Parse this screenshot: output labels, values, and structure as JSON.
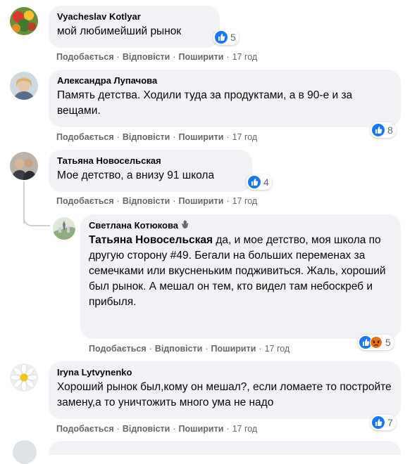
{
  "comments": [
    {
      "author": "Vyacheslav Kotlyar",
      "text": "мой любимейший рынок",
      "reactions": "5",
      "like": "Подобається",
      "reply": "Відповісти",
      "share": "Поширити",
      "time": "17 год"
    },
    {
      "author": "Александра Лупачова",
      "text": "Память детства. Ходили туда за продуктами, а в 90-е и за вещами.",
      "reactions": "8",
      "like": "Подобається",
      "reply": "Відповісти",
      "share": "Поширити",
      "time": "17 год"
    },
    {
      "author": "Татьяна Новосельская",
      "text": "Мое детство, а внизу 91 школа",
      "reactions": "4",
      "like": "Подобається",
      "reply": "Відповісти",
      "share": "Поширити",
      "time": "17 год"
    },
    {
      "author": "Светлана Котюкова",
      "mention": "Татьяна Новосельская",
      "text": " да, и мое детство, моя школа по другую сторону #49. Бегали на больших переменах за семечками или вкусненьким подживиться. Жаль, хороший был рынок. А мешал он тем, кто видел там небоскреб и прибыля.",
      "reactions": "5",
      "like": "Подобається",
      "reply": "Відповісти",
      "share": "Поширити",
      "time": "17 год"
    },
    {
      "author": "Iryna Lytvynenko",
      "text": "Хороший рынок был,кому он мешал?, если ломаете то постройте замену,а то уничтожить много ума не надо",
      "reactions": "7",
      "like": "Подобається",
      "reply": "Відповісти",
      "share": "Поширити",
      "time": "17 год"
    }
  ],
  "colors": {
    "bubble": "#f0f2f5",
    "like_blue": "#1877f2",
    "muted": "#65676b",
    "angry": "#e9710f"
  }
}
